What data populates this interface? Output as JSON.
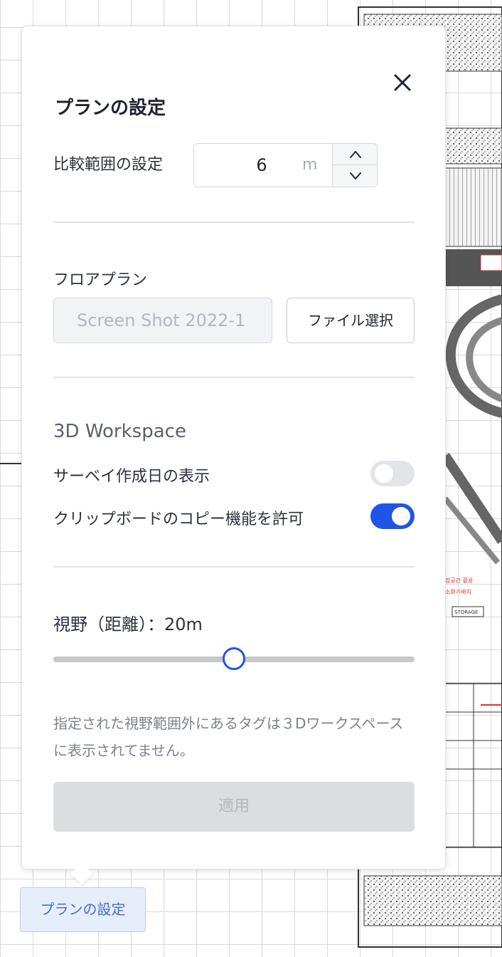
{
  "panel": {
    "title": "プランの設定",
    "close_icon": "close-icon"
  },
  "comparison": {
    "label": "比較範囲の設定",
    "value": "6",
    "unit": "m",
    "increment_icon": "chevron-up-icon",
    "decrement_icon": "chevron-down-icon"
  },
  "floorplan": {
    "label": "フロアプラン",
    "file_name": "Screen Shot 2022-1",
    "choose_button": "ファイル選択"
  },
  "workspace": {
    "title": "3D Workspace",
    "toggles": [
      {
        "label": "サーベイ作成日の表示",
        "on": false
      },
      {
        "label": "クリップボードのコピー機能を許可",
        "on": true
      }
    ]
  },
  "view": {
    "label": "視野（距離）：20m",
    "slider_value": 20,
    "help_text": "指定された視野範囲外にあるタグは３Dワークスペースに表示されてません。",
    "apply_button": "適用"
  },
  "trigger_button": "プランの設定",
  "colors": {
    "accent": "#1f55e6",
    "toggle_off": "#e3e4e8",
    "disabled_button": "#dcdddf",
    "trigger_bg": "#e6eefc"
  }
}
